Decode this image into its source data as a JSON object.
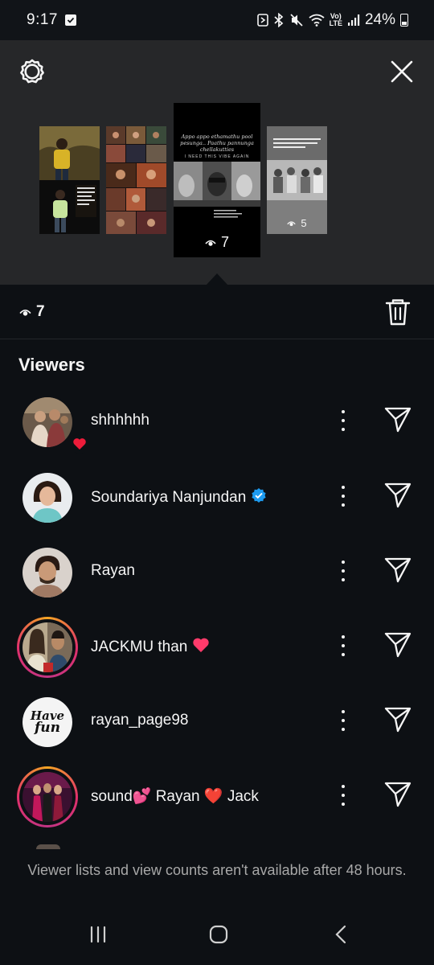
{
  "status_bar": {
    "time": "9:17",
    "volte_top": "Vo)",
    "volte_bottom": "LTE",
    "battery": "24%"
  },
  "story_tray": {
    "settings_icon": "settings-gear-icon",
    "close_icon": "close-icon",
    "thumbnails": [
      {
        "id": "story-1",
        "views": ""
      },
      {
        "id": "story-2",
        "views": ""
      },
      {
        "id": "story-3",
        "views": "7",
        "selected": true
      },
      {
        "id": "story-4",
        "views": "5"
      }
    ],
    "story3_caption_1": "Appo appo ethamathu pool",
    "story3_caption_2": "pesunga.. Paathu pannunga",
    "story3_caption_3": "chellakutties",
    "story3_caption_4": "I NEED THIS VIBE AGAIN"
  },
  "count_row": {
    "views": "7",
    "eye_icon": "eye-icon",
    "trash_icon": "trash-icon"
  },
  "viewers_title": "Viewers",
  "viewers": [
    {
      "name": "shhhhhh",
      "liked": true,
      "verified": false,
      "story_ring": false,
      "suffix": ""
    },
    {
      "name": "Soundariya Nanjundan",
      "liked": false,
      "verified": true,
      "story_ring": false,
      "suffix": ""
    },
    {
      "name": "Rayan",
      "liked": false,
      "verified": false,
      "story_ring": false,
      "suffix": ""
    },
    {
      "name": "JACKMU than",
      "liked": false,
      "verified": false,
      "story_ring": true,
      "suffix": "❤️"
    },
    {
      "name": "rayan_page98",
      "liked": false,
      "verified": false,
      "story_ring": false,
      "suffix": ""
    },
    {
      "name": "sound💕 Rayan ❤️ Jack",
      "liked": false,
      "verified": false,
      "story_ring": true,
      "suffix": ""
    }
  ],
  "avatar_5_text_1": "Have",
  "avatar_5_text_2": "fun",
  "footer_note": "Viewer lists and view counts aren't available after 48 hours.",
  "colors": {
    "background": "#0d1014",
    "story_tray": "#262729",
    "verified": "#1d9bf0",
    "like": "#ed4956"
  }
}
